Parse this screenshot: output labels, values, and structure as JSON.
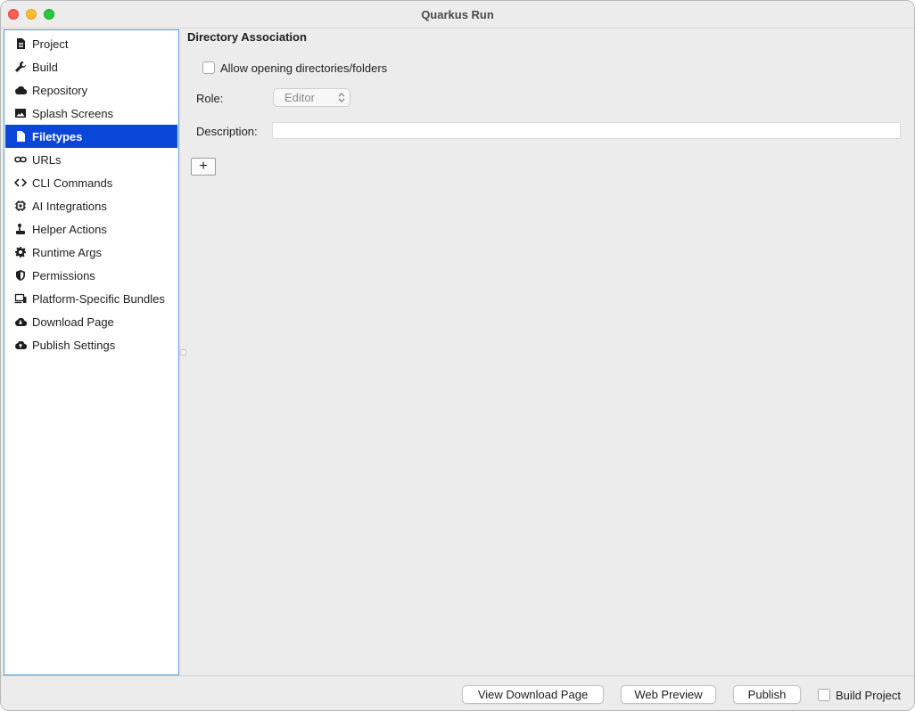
{
  "window": {
    "title": "Quarkus Run"
  },
  "sidebar": {
    "items": [
      {
        "label": "Project",
        "icon": "document-icon"
      },
      {
        "label": "Build",
        "icon": "wrench-icon"
      },
      {
        "label": "Repository",
        "icon": "cloud-icon"
      },
      {
        "label": "Splash Screens",
        "icon": "image-icon"
      },
      {
        "label": "Filetypes",
        "icon": "file-icon",
        "selected": true
      },
      {
        "label": "URLs",
        "icon": "link-icon"
      },
      {
        "label": "CLI Commands",
        "icon": "code-icon"
      },
      {
        "label": "AI Integrations",
        "icon": "chip-icon"
      },
      {
        "label": "Helper Actions",
        "icon": "joystick-icon"
      },
      {
        "label": "Runtime Args",
        "icon": "gear-icon"
      },
      {
        "label": "Permissions",
        "icon": "shield-icon"
      },
      {
        "label": "Platform-Specific Bundles",
        "icon": "devices-icon"
      },
      {
        "label": "Download Page",
        "icon": "cloud-download-icon"
      },
      {
        "label": "Publish Settings",
        "icon": "cloud-upload-icon"
      }
    ]
  },
  "main": {
    "section_title": "Directory Association",
    "allow_dirs": {
      "label": "Allow opening directories/folders",
      "checked": false
    },
    "role": {
      "label": "Role:",
      "value": "Editor"
    },
    "description": {
      "label": "Description:",
      "value": ""
    },
    "add_button": "+"
  },
  "footer": {
    "view_download_page": "View Download Page",
    "web_preview": "Web Preview",
    "publish": "Publish",
    "build_project": {
      "label": "Build Project",
      "checked": false
    }
  },
  "colors": {
    "selection": "#0a47d9",
    "sidebar_border": "#5a9bd5"
  }
}
